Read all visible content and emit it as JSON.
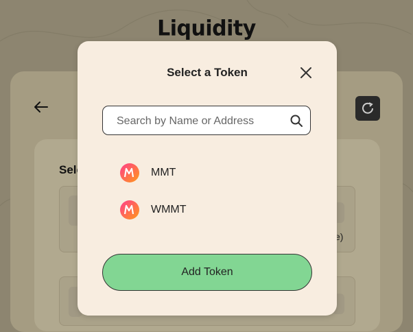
{
  "page": {
    "title": "Liquidity"
  },
  "background": {
    "select_label": "Sele",
    "slot_suffix": "e)"
  },
  "modal": {
    "title": "Select a Token",
    "search": {
      "placeholder": "Search by Name or Address",
      "value": ""
    },
    "tokens": [
      {
        "symbol": "MMT",
        "icon": "mmt-token-icon"
      },
      {
        "symbol": "WMMT",
        "icon": "mmt-token-icon"
      }
    ],
    "add_button_label": "Add Token"
  },
  "colors": {
    "modal_bg": "#f8ede0",
    "accent_button": "#82d693",
    "overlay": "#8d8570"
  }
}
